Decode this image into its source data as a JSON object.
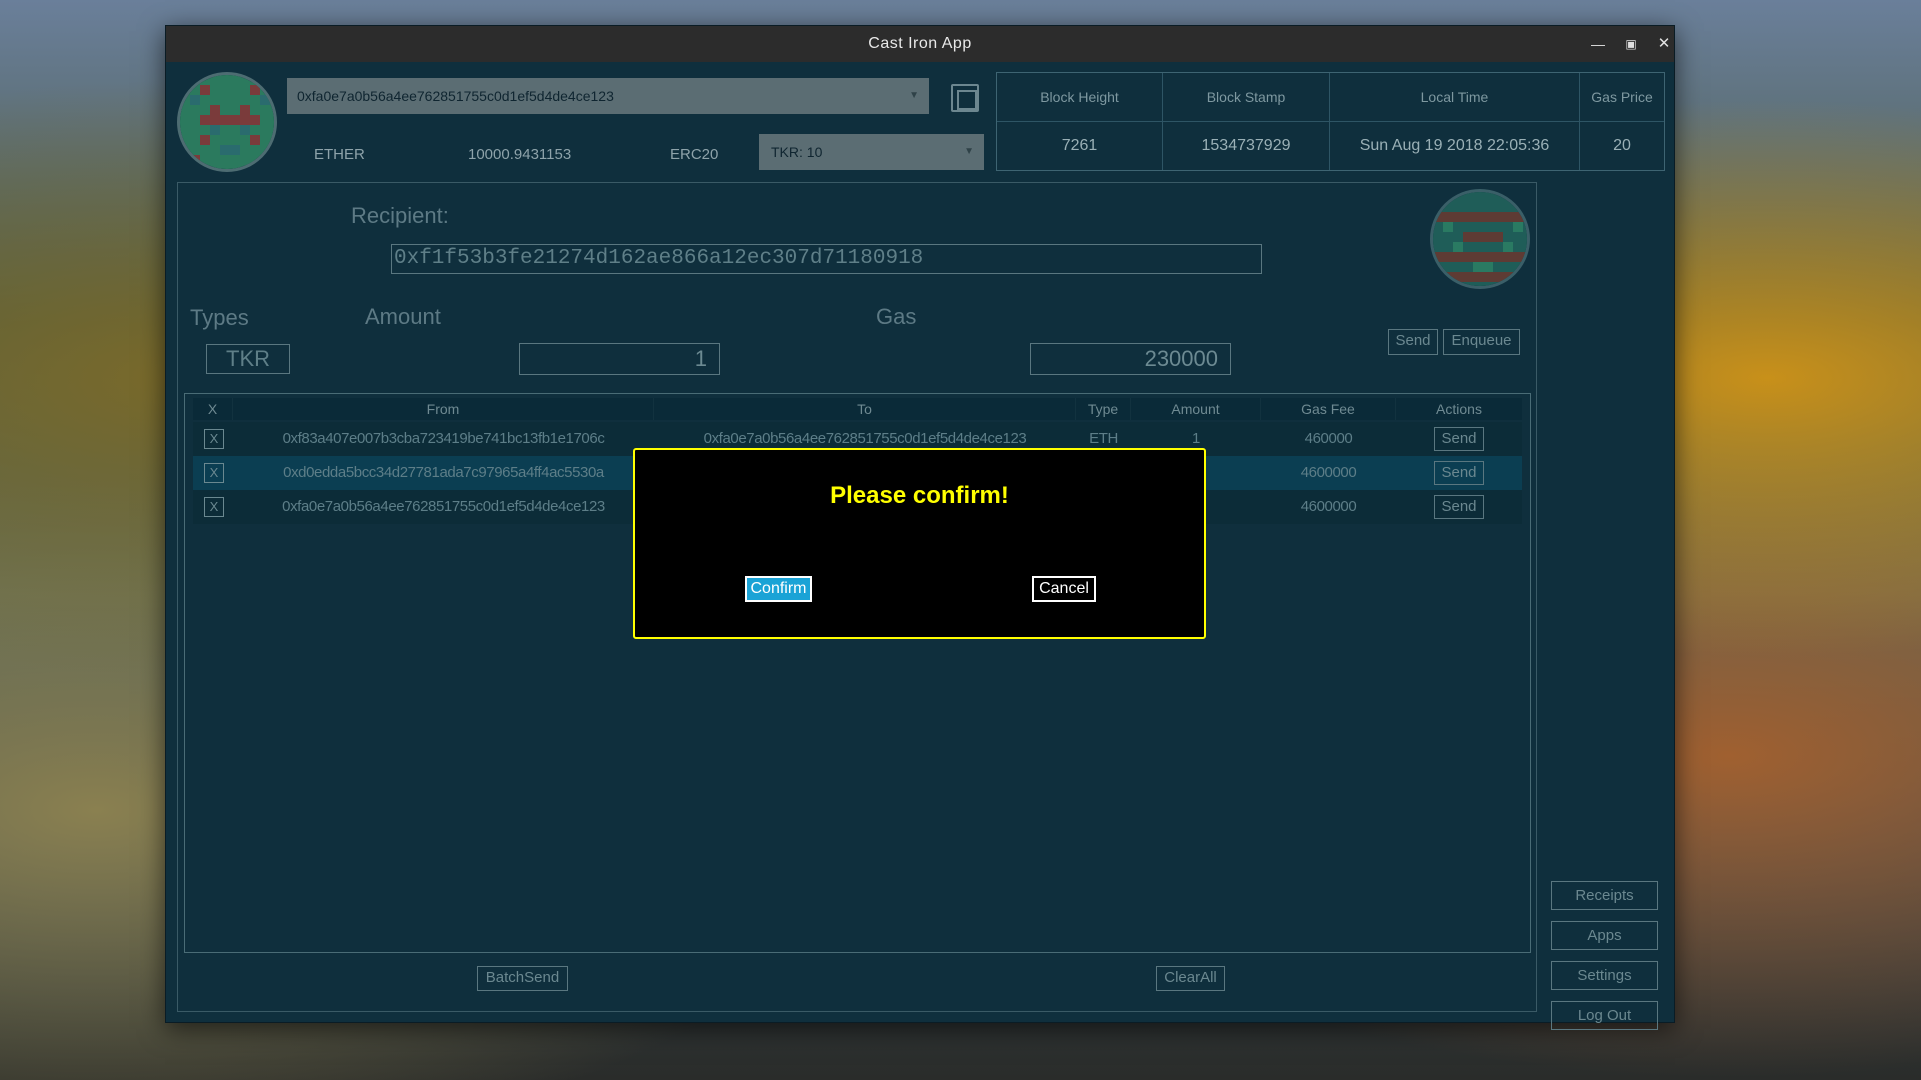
{
  "window": {
    "title": "Cast Iron App"
  },
  "wallet": {
    "address": "0xfa0e7a0b56a4ee762851755c0d1ef5d4de4ce123",
    "ether_label": "ETHER",
    "ether_balance": "10000.9431153",
    "erc20_label": "ERC20",
    "token_selected": "TKR: 10"
  },
  "chain_info": {
    "headers": [
      "Block Height",
      "Block Stamp",
      "Local Time",
      "Gas Price"
    ],
    "values": [
      "7261",
      "1534737929",
      "Sun Aug 19 2018 22:05:36",
      "20"
    ]
  },
  "form": {
    "recipient_label": "Recipient:",
    "recipient_address": "0xf1f53b3fe21274d162ae866a12ec307d71180918",
    "types_label": "Types",
    "type_value": "TKR",
    "amount_label": "Amount",
    "amount_value": "1",
    "gas_label": "Gas",
    "gas_value": "230000",
    "send_label": "Send",
    "enqueue_label": "Enqueue"
  },
  "queue": {
    "headers": [
      "X",
      "From",
      "To",
      "Type",
      "Amount",
      "Gas Fee",
      "Actions"
    ],
    "rows": [
      {
        "x": "X",
        "from": "0xf83a407e007b3cba723419be741bc13fb1e1706c",
        "to": "0xfa0e7a0b56a4ee762851755c0d1ef5d4de4ce123",
        "type": "ETH",
        "amount": "1",
        "gas_fee": "460000",
        "action": "Send"
      },
      {
        "x": "X",
        "from": "0xd0edda5bcc34d27781ada7c97965a4ff4ac5530a",
        "to": "",
        "type": "",
        "amount": "",
        "gas_fee": "4600000",
        "action": "Send"
      },
      {
        "x": "X",
        "from": "0xfa0e7a0b56a4ee762851755c0d1ef5d4de4ce123",
        "to": "",
        "type": "",
        "amount": "",
        "gas_fee": "4600000",
        "action": "Send"
      }
    ],
    "batch_send_label": "BatchSend",
    "clear_all_label": "ClearAll"
  },
  "side_nav": [
    "Receipts",
    "Apps",
    "Settings",
    "Log Out"
  ],
  "dialog": {
    "title": "Please confirm!",
    "confirm_label": "Confirm",
    "cancel_label": "Cancel"
  },
  "colors": {
    "window_bg": "#0f2f3d",
    "dialog_title": "#ffff00",
    "dialog_border": "#ffff00",
    "confirm_bg": "#1aa3d6"
  },
  "icons": [
    "minimize-icon",
    "maximize-icon",
    "close-icon",
    "chevron-down-icon",
    "copy-icon"
  ]
}
